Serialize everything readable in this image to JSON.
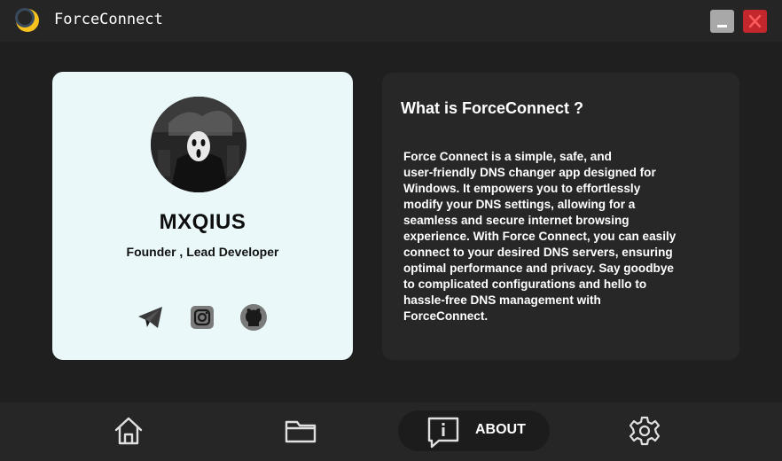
{
  "window": {
    "title": "ForceConnect",
    "logo_icon": "crescent-moon-logo",
    "minimize_icon": "minimize-icon",
    "close_icon": "close-icon"
  },
  "profile": {
    "name": "MXQIUS",
    "role": "Founder , Lead Developer",
    "avatar": "masked-figure-avatar",
    "socials": [
      {
        "name": "telegram",
        "icon": "telegram-icon"
      },
      {
        "name": "instagram",
        "icon": "instagram-icon"
      },
      {
        "name": "github",
        "icon": "github-icon"
      }
    ]
  },
  "info": {
    "title": "What is ForceConnect ?",
    "lines": [
      "Force Connect is a simple, safe, and",
      "user-friendly DNS changer app designed for",
      "Windows. It empowers you to effortlessly",
      "modify your DNS settings, allowing for a",
      "seamless and secure internet browsing",
      "experience. With Force Connect, you can easily",
      "connect to your desired DNS servers, ensuring",
      "optimal performance and privacy. Say goodbye",
      "to complicated configurations and hello to",
      "hassle-free DNS management with",
      "ForceConnect."
    ]
  },
  "nav": {
    "items": [
      {
        "name": "home",
        "icon": "home-icon",
        "active": false
      },
      {
        "name": "folder",
        "icon": "folder-icon",
        "active": false
      },
      {
        "name": "about",
        "icon": "about-icon",
        "label": "ABOUT",
        "active": true
      },
      {
        "name": "settings",
        "icon": "gear-icon",
        "active": false
      }
    ]
  },
  "colors": {
    "background": "#1f1f1f",
    "card_light": "#eaf8fa",
    "card_dark": "#272727",
    "close_red": "#c1272d",
    "logo_yellow": "#f5c11c"
  }
}
